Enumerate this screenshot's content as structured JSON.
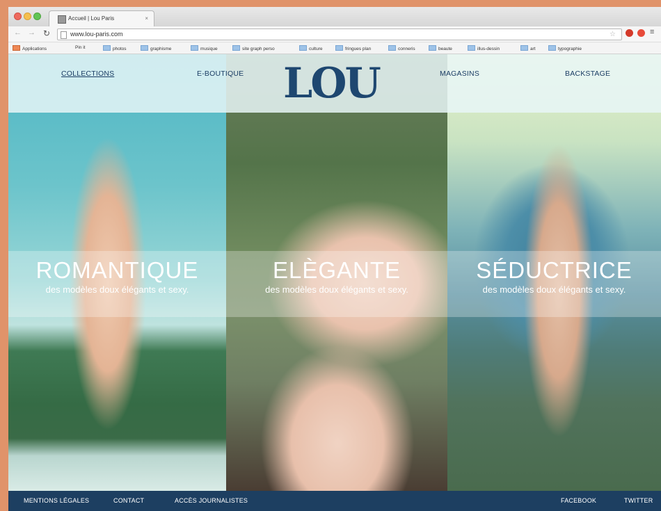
{
  "browser": {
    "tab_title": "Accueil | Lou Paris",
    "tab_close": "×",
    "url": "www.lou-paris.com",
    "bookmarks": [
      "Applications",
      "Pin it",
      "photos",
      "graphisme",
      "musique",
      "site graph perso",
      "culture",
      "fringues plan",
      "conneris",
      "beaute",
      "illus-dessin",
      "art",
      "typographie"
    ]
  },
  "header": {
    "logo": "LOU",
    "nav": [
      "COLLECTIONS",
      "E-BOUTIQUE",
      "MAGASINS",
      "BACKSTAGE"
    ]
  },
  "panels": [
    {
      "title": "ROMANTIQUE",
      "subtitle": "des modèles doux élégants et sexy."
    },
    {
      "title": "ELÈGANTE",
      "subtitle": "des modèles doux élégants et sexy."
    },
    {
      "title": "SÉDUCTRICE",
      "subtitle": "des modèles doux élégants et sexy."
    }
  ],
  "footer": {
    "links_left": [
      "MENTIONS LÉGALES",
      "CONTACT",
      "ACCÈS JOURNALISTES"
    ],
    "links_right": [
      "FACEBOOK",
      "TWITTER"
    ]
  },
  "colors": {
    "accent": "#1e4770",
    "footer_bg": "#1d3f61",
    "desktop_bg": "#e0936a"
  }
}
